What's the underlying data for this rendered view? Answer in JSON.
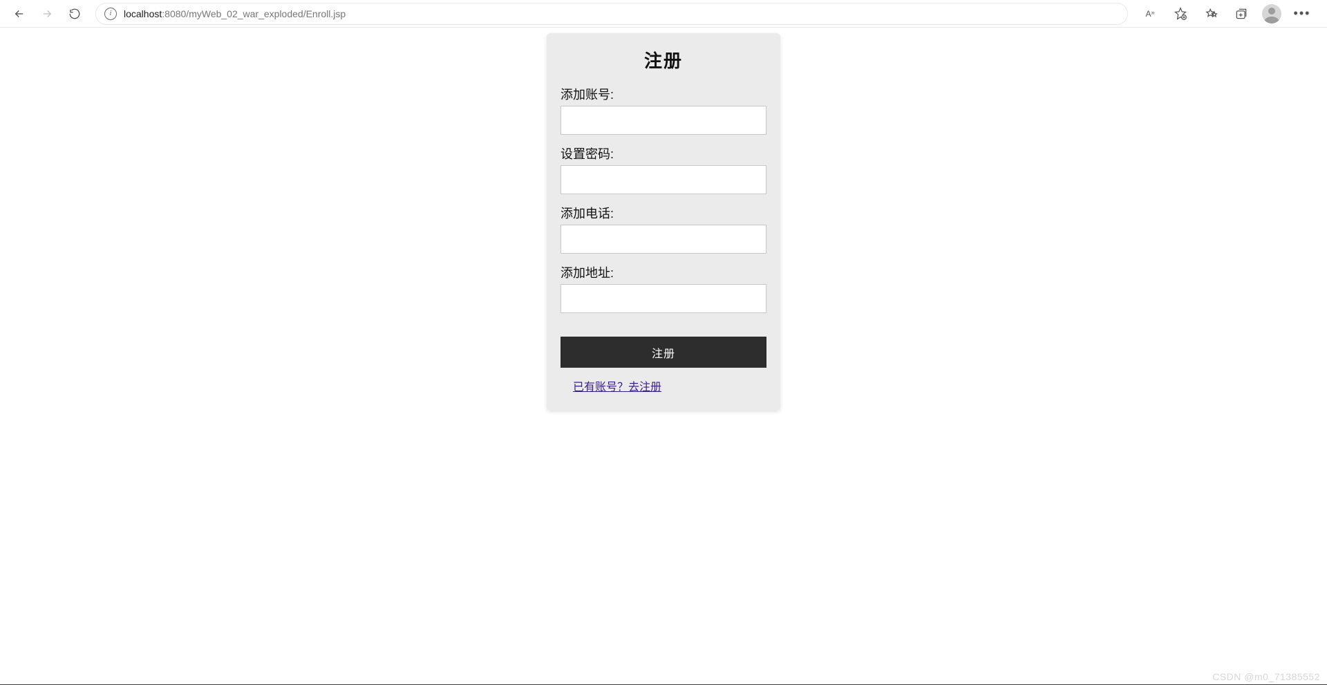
{
  "browser": {
    "url_prefix": "localhost",
    "url_rest": ":8080/myWeb_02_war_exploded/Enroll.jsp",
    "read_aloud_label": "A",
    "read_aloud_sup": "»"
  },
  "form": {
    "title": "注册",
    "fields": {
      "account": {
        "label": "添加账号:",
        "value": ""
      },
      "password": {
        "label": "设置密码:",
        "value": ""
      },
      "phone": {
        "label": "添加电话:",
        "value": ""
      },
      "address": {
        "label": "添加地址:",
        "value": ""
      }
    },
    "submit_label": "注册",
    "login_link_text": "已有账号？去注册"
  },
  "watermark": "CSDN @m0_71385552"
}
